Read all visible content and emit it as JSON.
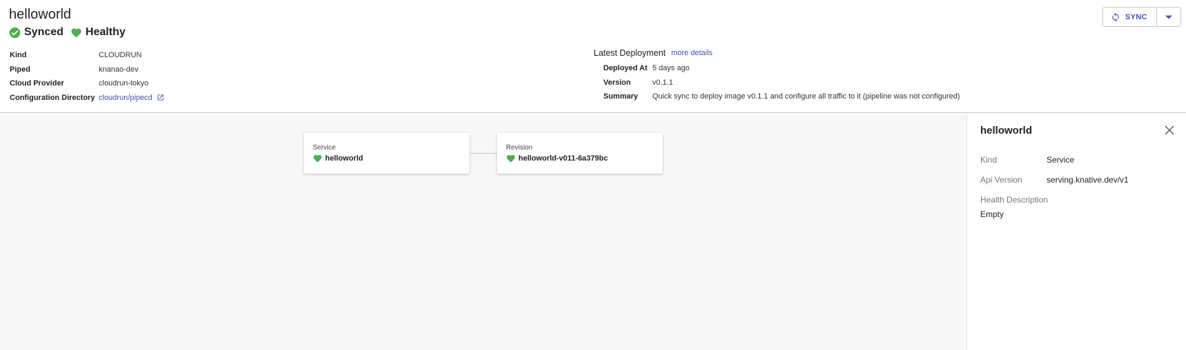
{
  "app": {
    "title": "helloworld",
    "sync_status": "Synced",
    "health_status": "Healthy"
  },
  "info": [
    {
      "label": "Kind",
      "value": "CLOUDRUN"
    },
    {
      "label": "Piped",
      "value": "knanao-dev"
    },
    {
      "label": "Cloud Provider",
      "value": "cloudrun-tokyo"
    },
    {
      "label": "Configuration Directory",
      "value": "cloudrun/pipecd"
    }
  ],
  "deployment": {
    "title": "Latest Deployment",
    "more_details": "more details",
    "rows": [
      {
        "label": "Deployed At",
        "value": "5 days ago"
      },
      {
        "label": "Version",
        "value": "v0.1.1"
      },
      {
        "label": "Summary",
        "value": "Quick sync to deploy image v0.1.1 and configure all traffic to it (pipeline was not configured)"
      }
    ]
  },
  "toolbar": {
    "sync_label": "SYNC"
  },
  "graph": {
    "nodes": [
      {
        "kind": "Service",
        "name": "helloworld"
      },
      {
        "kind": "Revision",
        "name": "helloworld-v011-6a379bc"
      }
    ]
  },
  "detail": {
    "title": "helloworld",
    "kind_label": "Kind",
    "kind_value": "Service",
    "api_label": "Api Version",
    "api_value": "serving.knative.dev/v1",
    "health_label": "Health Description",
    "health_value": "Empty"
  },
  "colors": {
    "healthy": "#4caf50",
    "link": "#3f51b5"
  }
}
